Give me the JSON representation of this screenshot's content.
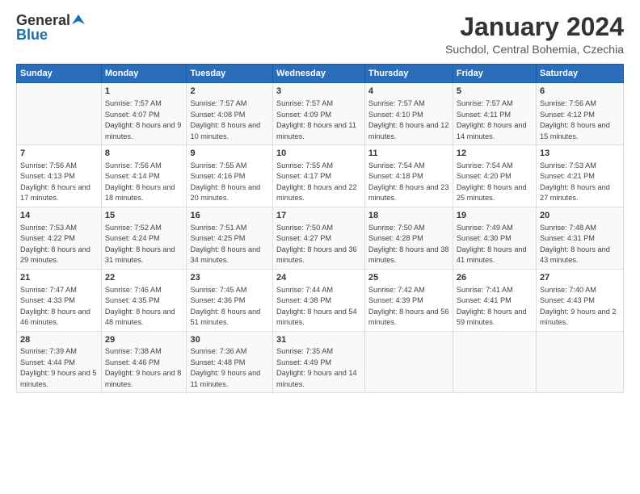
{
  "header": {
    "logo": {
      "general": "General",
      "blue": "Blue"
    },
    "title": "January 2024",
    "subtitle": "Suchdol, Central Bohemia, Czechia"
  },
  "days_of_week": [
    "Sunday",
    "Monday",
    "Tuesday",
    "Wednesday",
    "Thursday",
    "Friday",
    "Saturday"
  ],
  "weeks": [
    [
      {
        "day": "",
        "sunrise": "",
        "sunset": "",
        "daylight": ""
      },
      {
        "day": "1",
        "sunrise": "7:57 AM",
        "sunset": "4:07 PM",
        "daylight": "8 hours and 9 minutes."
      },
      {
        "day": "2",
        "sunrise": "7:57 AM",
        "sunset": "4:08 PM",
        "daylight": "8 hours and 10 minutes."
      },
      {
        "day": "3",
        "sunrise": "7:57 AM",
        "sunset": "4:09 PM",
        "daylight": "8 hours and 11 minutes."
      },
      {
        "day": "4",
        "sunrise": "7:57 AM",
        "sunset": "4:10 PM",
        "daylight": "8 hours and 12 minutes."
      },
      {
        "day": "5",
        "sunrise": "7:57 AM",
        "sunset": "4:11 PM",
        "daylight": "8 hours and 14 minutes."
      },
      {
        "day": "6",
        "sunrise": "7:56 AM",
        "sunset": "4:12 PM",
        "daylight": "8 hours and 15 minutes."
      }
    ],
    [
      {
        "day": "7",
        "sunrise": "7:56 AM",
        "sunset": "4:13 PM",
        "daylight": "8 hours and 17 minutes."
      },
      {
        "day": "8",
        "sunrise": "7:56 AM",
        "sunset": "4:14 PM",
        "daylight": "8 hours and 18 minutes."
      },
      {
        "day": "9",
        "sunrise": "7:55 AM",
        "sunset": "4:16 PM",
        "daylight": "8 hours and 20 minutes."
      },
      {
        "day": "10",
        "sunrise": "7:55 AM",
        "sunset": "4:17 PM",
        "daylight": "8 hours and 22 minutes."
      },
      {
        "day": "11",
        "sunrise": "7:54 AM",
        "sunset": "4:18 PM",
        "daylight": "8 hours and 23 minutes."
      },
      {
        "day": "12",
        "sunrise": "7:54 AM",
        "sunset": "4:20 PM",
        "daylight": "8 hours and 25 minutes."
      },
      {
        "day": "13",
        "sunrise": "7:53 AM",
        "sunset": "4:21 PM",
        "daylight": "8 hours and 27 minutes."
      }
    ],
    [
      {
        "day": "14",
        "sunrise": "7:53 AM",
        "sunset": "4:22 PM",
        "daylight": "8 hours and 29 minutes."
      },
      {
        "day": "15",
        "sunrise": "7:52 AM",
        "sunset": "4:24 PM",
        "daylight": "8 hours and 31 minutes."
      },
      {
        "day": "16",
        "sunrise": "7:51 AM",
        "sunset": "4:25 PM",
        "daylight": "8 hours and 34 minutes."
      },
      {
        "day": "17",
        "sunrise": "7:50 AM",
        "sunset": "4:27 PM",
        "daylight": "8 hours and 36 minutes."
      },
      {
        "day": "18",
        "sunrise": "7:50 AM",
        "sunset": "4:28 PM",
        "daylight": "8 hours and 38 minutes."
      },
      {
        "day": "19",
        "sunrise": "7:49 AM",
        "sunset": "4:30 PM",
        "daylight": "8 hours and 41 minutes."
      },
      {
        "day": "20",
        "sunrise": "7:48 AM",
        "sunset": "4:31 PM",
        "daylight": "8 hours and 43 minutes."
      }
    ],
    [
      {
        "day": "21",
        "sunrise": "7:47 AM",
        "sunset": "4:33 PM",
        "daylight": "8 hours and 46 minutes."
      },
      {
        "day": "22",
        "sunrise": "7:46 AM",
        "sunset": "4:35 PM",
        "daylight": "8 hours and 48 minutes."
      },
      {
        "day": "23",
        "sunrise": "7:45 AM",
        "sunset": "4:36 PM",
        "daylight": "8 hours and 51 minutes."
      },
      {
        "day": "24",
        "sunrise": "7:44 AM",
        "sunset": "4:38 PM",
        "daylight": "8 hours and 54 minutes."
      },
      {
        "day": "25",
        "sunrise": "7:42 AM",
        "sunset": "4:39 PM",
        "daylight": "8 hours and 56 minutes."
      },
      {
        "day": "26",
        "sunrise": "7:41 AM",
        "sunset": "4:41 PM",
        "daylight": "8 hours and 59 minutes."
      },
      {
        "day": "27",
        "sunrise": "7:40 AM",
        "sunset": "4:43 PM",
        "daylight": "9 hours and 2 minutes."
      }
    ],
    [
      {
        "day": "28",
        "sunrise": "7:39 AM",
        "sunset": "4:44 PM",
        "daylight": "9 hours and 5 minutes."
      },
      {
        "day": "29",
        "sunrise": "7:38 AM",
        "sunset": "4:46 PM",
        "daylight": "9 hours and 8 minutes."
      },
      {
        "day": "30",
        "sunrise": "7:36 AM",
        "sunset": "4:48 PM",
        "daylight": "9 hours and 11 minutes."
      },
      {
        "day": "31",
        "sunrise": "7:35 AM",
        "sunset": "4:49 PM",
        "daylight": "9 hours and 14 minutes."
      },
      {
        "day": "",
        "sunrise": "",
        "sunset": "",
        "daylight": ""
      },
      {
        "day": "",
        "sunrise": "",
        "sunset": "",
        "daylight": ""
      },
      {
        "day": "",
        "sunrise": "",
        "sunset": "",
        "daylight": ""
      }
    ]
  ]
}
